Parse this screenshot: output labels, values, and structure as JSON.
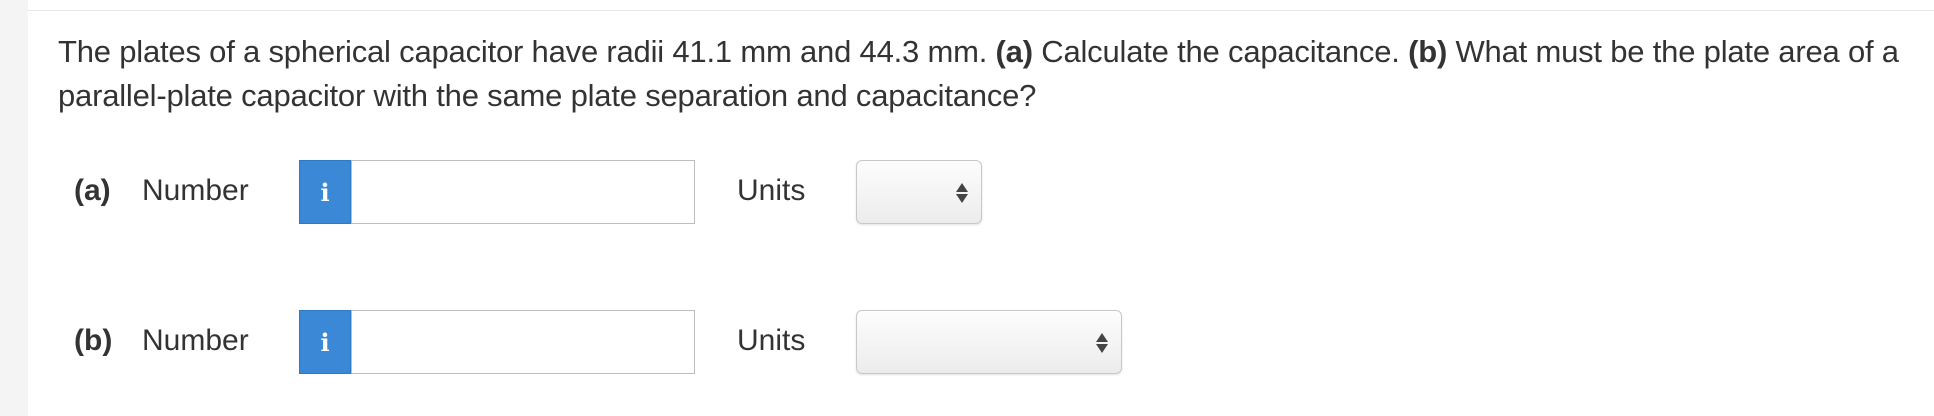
{
  "question": {
    "text_1": "The plates of a spherical capacitor have radii 41.1 mm and 44.3 mm. ",
    "part_a_marker": "(a)",
    "text_2": " Calculate the capacitance. ",
    "part_b_marker": "(b)",
    "text_3": " What must be the plate area of a parallel-plate capacitor with the same plate separation and capacitance?"
  },
  "parts": [
    {
      "label": "(a)",
      "number_label": "Number",
      "info_icon": "info-icon",
      "info_glyph": "i",
      "number_value": "",
      "units_label": "Units",
      "units_selected": ""
    },
    {
      "label": "(b)",
      "number_label": "Number",
      "info_icon": "info-icon",
      "info_glyph": "i",
      "number_value": "",
      "units_label": "Units",
      "units_selected": ""
    }
  ],
  "colors": {
    "info_button": "#3b88d6",
    "text": "#333333",
    "gutter": "#f4f4f4"
  }
}
